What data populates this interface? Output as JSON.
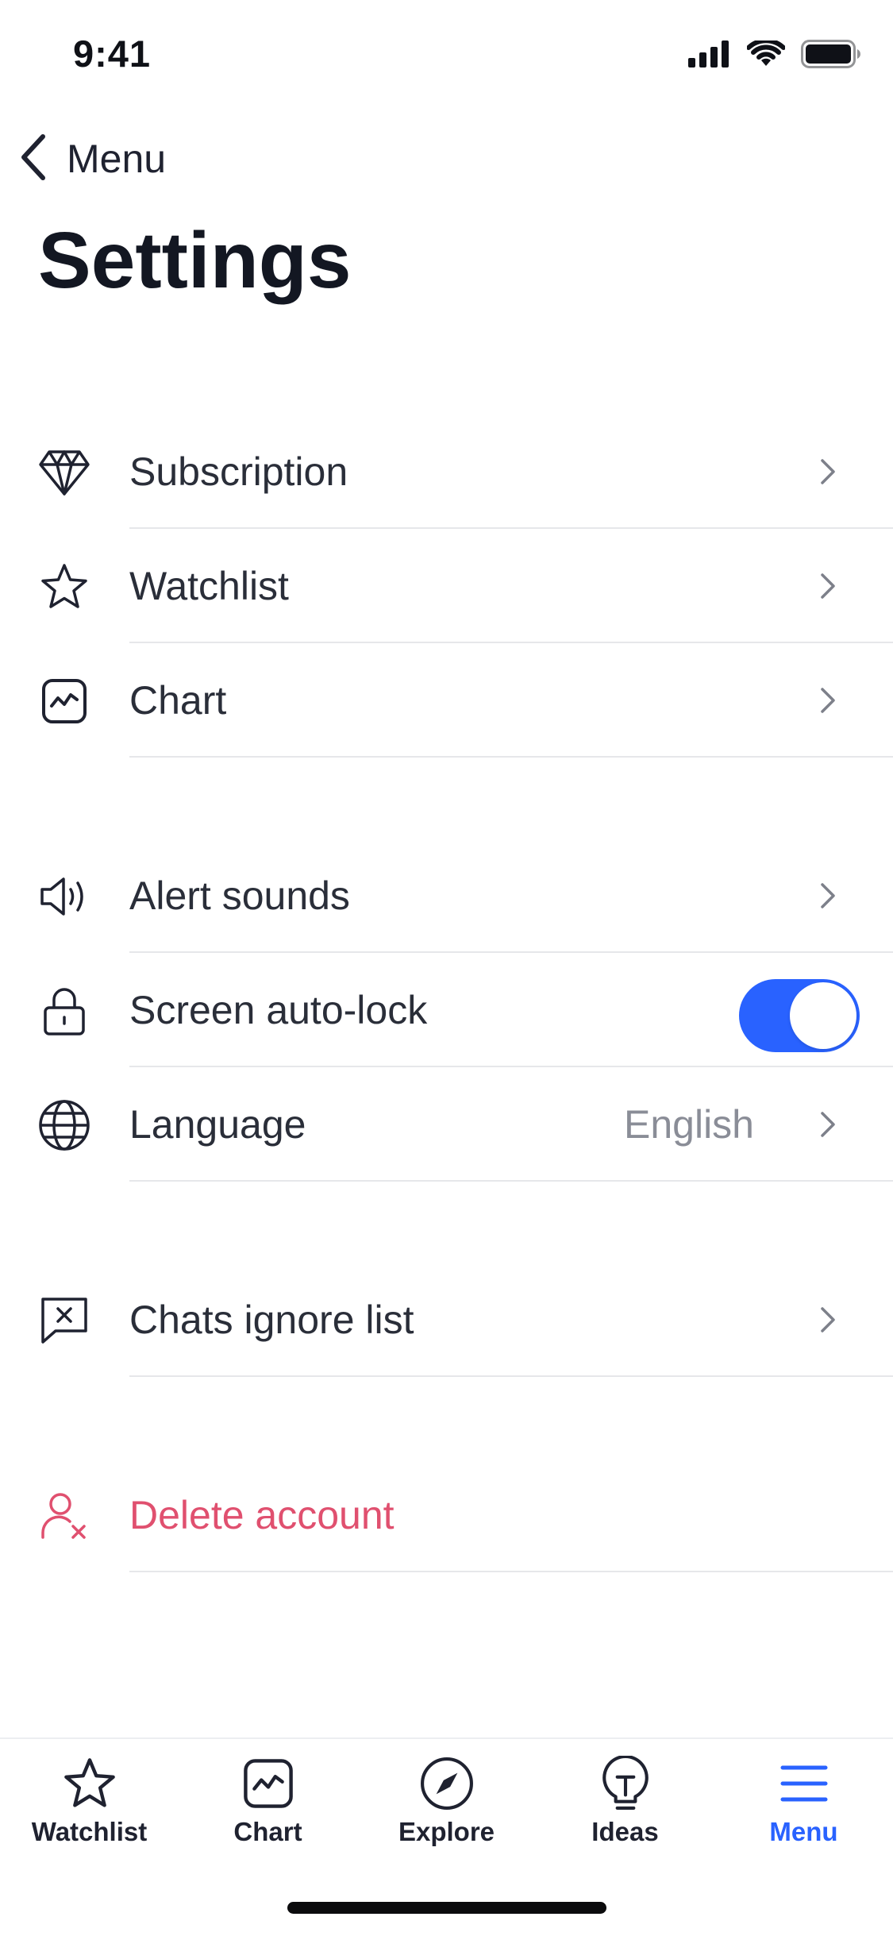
{
  "status_bar": {
    "time": "9:41"
  },
  "nav": {
    "back_label": "Menu"
  },
  "page": {
    "title": "Settings"
  },
  "settings": {
    "group1": [
      {
        "label": "Subscription",
        "icon": "diamond-icon"
      },
      {
        "label": "Watchlist",
        "icon": "star-icon"
      },
      {
        "label": "Chart",
        "icon": "chart-icon"
      }
    ],
    "group2": [
      {
        "label": "Alert sounds",
        "icon": "speaker-icon"
      },
      {
        "label": "Screen auto-lock",
        "icon": "lock-icon",
        "toggle_on": true
      },
      {
        "label": "Language",
        "icon": "globe-icon",
        "value": "English"
      }
    ],
    "group3": [
      {
        "label": "Chats ignore list",
        "icon": "chat-blocked-icon"
      }
    ],
    "group4": [
      {
        "label": "Delete account",
        "icon": "user-remove-icon"
      }
    ]
  },
  "tab_bar": {
    "tabs": [
      {
        "label": "Watchlist",
        "icon": "star-icon"
      },
      {
        "label": "Chart",
        "icon": "chart-icon"
      },
      {
        "label": "Explore",
        "icon": "compass-icon"
      },
      {
        "label": "Ideas",
        "icon": "lightbulb-icon"
      },
      {
        "label": "Menu",
        "icon": "hamburger-icon",
        "active": true
      }
    ]
  },
  "colors": {
    "accent": "#2962ff",
    "danger": "#e0506f",
    "text": "#2a2e39",
    "secondary_text": "#8a8d97",
    "divider": "#e6e7ea"
  }
}
